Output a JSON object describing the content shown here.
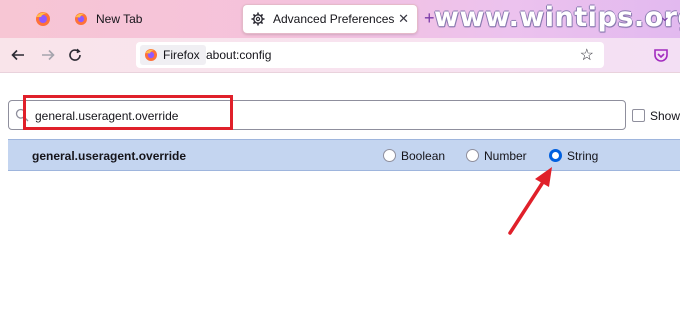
{
  "tabs": [
    {
      "label": "New Tab",
      "favicon": "firefox-logo-icon"
    },
    {
      "label": "Advanced Preferences",
      "favicon": "gear-icon",
      "active": true
    }
  ],
  "watermark": "www.wintips.org",
  "toolbar": {
    "identity_label": "Firefox",
    "url": "about:config"
  },
  "search": {
    "value": "general.useragent.override",
    "show_label": "Show"
  },
  "preference": {
    "name": "general.useragent.override",
    "types": [
      {
        "label": "Boolean",
        "checked": false
      },
      {
        "label": "Number",
        "checked": false
      },
      {
        "label": "String",
        "checked": true
      }
    ]
  },
  "colors": {
    "accent": "#0060df",
    "annotation_red": "#e0202a",
    "row_highlight": "#c4d5f0"
  }
}
